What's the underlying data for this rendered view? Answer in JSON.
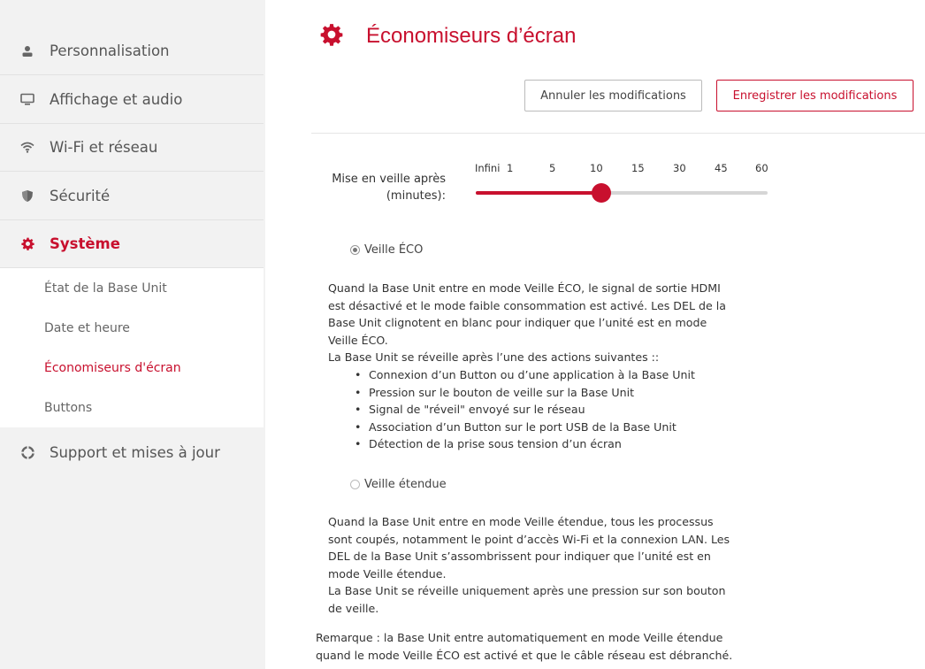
{
  "sidebar": {
    "items": [
      {
        "label": "Personnalisation",
        "icon": "person-icon"
      },
      {
        "label": "Affichage et audio",
        "icon": "monitor-icon"
      },
      {
        "label": "Wi-Fi et réseau",
        "icon": "wifi-icon"
      },
      {
        "label": "Sécurité",
        "icon": "shield-icon"
      },
      {
        "label": "Système",
        "icon": "gear-icon",
        "active": true
      },
      {
        "label": "Support et mises à jour",
        "icon": "lifebuoy-icon"
      }
    ],
    "subitems": [
      {
        "label": "État de la Base Unit"
      },
      {
        "label": "Date et heure"
      },
      {
        "label": "Économiseurs d'écran",
        "active": true
      },
      {
        "label": "Buttons"
      }
    ]
  },
  "main": {
    "title": "Économiseurs d’écran",
    "title_icon": "gear-icon",
    "cancel_label": "Annuler les modifications",
    "save_label": "Enregistrer les modifications",
    "slider": {
      "label_line1": "Mise en veille après",
      "label_line2": "(minutes):",
      "ticks": [
        "Infini",
        "1",
        "5",
        "10",
        "15",
        "30",
        "45",
        "60"
      ],
      "selected": "10"
    },
    "eco": {
      "label": "Veille ÉCO",
      "selected": true,
      "desc": [
        "Quand la Base Unit entre en mode Veille ÉCO, le signal de sortie HDMI",
        "est désactivé et le mode faible consommation est activé. Les DEL de la",
        "Base Unit clignotent en blanc pour indiquer que l’unité est en mode",
        "Veille ÉCO."
      ],
      "wake_intro": "La Base Unit se réveille après l’une des actions suivantes ::",
      "bullets": [
        "Connexion d’un Button ou d’une application à la Base Unit",
        "Pression sur le bouton de veille sur la Base Unit",
        "Signal de \"réveil\" envoyé sur le réseau",
        "Association d’un Button sur le port USB de la Base Unit",
        "Détection de la prise sous tension d’un écran"
      ]
    },
    "extended": {
      "label": "Veille étendue",
      "selected": false,
      "desc": [
        "Quand la Base Unit entre en mode Veille étendue, tous les processus",
        "sont coupés, notamment le point d’accès Wi-Fi et la connexion LAN. Les",
        "DEL de la Base Unit s’assombrissent pour indiquer que l’unité est en",
        "mode Veille étendue.",
        "La Base Unit se réveille uniquement après une pression sur son bouton",
        "de veille."
      ]
    },
    "note": [
      "Remarque : la Base Unit entre automatiquement en mode Veille étendue",
      "quand le mode Veille ÉCO est activé et que le câble réseau est débranché."
    ]
  },
  "colors": {
    "accent": "#c8102e",
    "sidebar_bg": "#f2f2f2",
    "text": "#444444"
  }
}
